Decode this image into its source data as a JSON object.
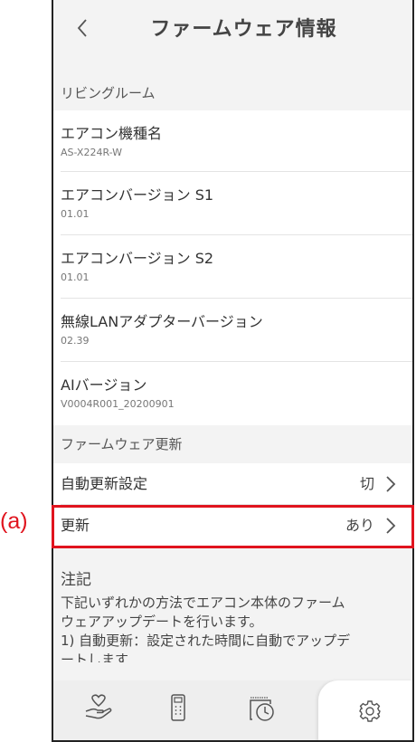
{
  "header": {
    "title": "ファームウェア情報"
  },
  "sections": {
    "room": "リビングルーム",
    "update": "ファームウェア更新"
  },
  "info_rows": [
    {
      "label": "エアコン機種名",
      "value": "AS-X224R-W"
    },
    {
      "label": "エアコンバージョン S1",
      "value": "01.01"
    },
    {
      "label": "エアコンバージョン S2",
      "value": "01.01"
    },
    {
      "label": "無線LANアダプターバージョン",
      "value": "02.39"
    },
    {
      "label": "AIバージョン",
      "value": "V0004R001_20200901"
    }
  ],
  "update_rows": [
    {
      "label": "自動更新設定",
      "value": "切"
    },
    {
      "label": "更新",
      "value": "あり"
    }
  ],
  "note": {
    "title": "注記",
    "lines": [
      "下記いずれかの方法でエアコン本体のファーム",
      "ウェアアップデートを行います。",
      "1) 自動更新：設定された時間に自動でアップデ",
      "ートします"
    ]
  },
  "callout": {
    "label": "(a)",
    "color": "#e0141e"
  },
  "icons": {
    "back": "chevron-left-icon",
    "tabs": [
      "hand-heart-icon",
      "remote-control-icon",
      "timer-clock-icon",
      "gear-icon"
    ]
  }
}
